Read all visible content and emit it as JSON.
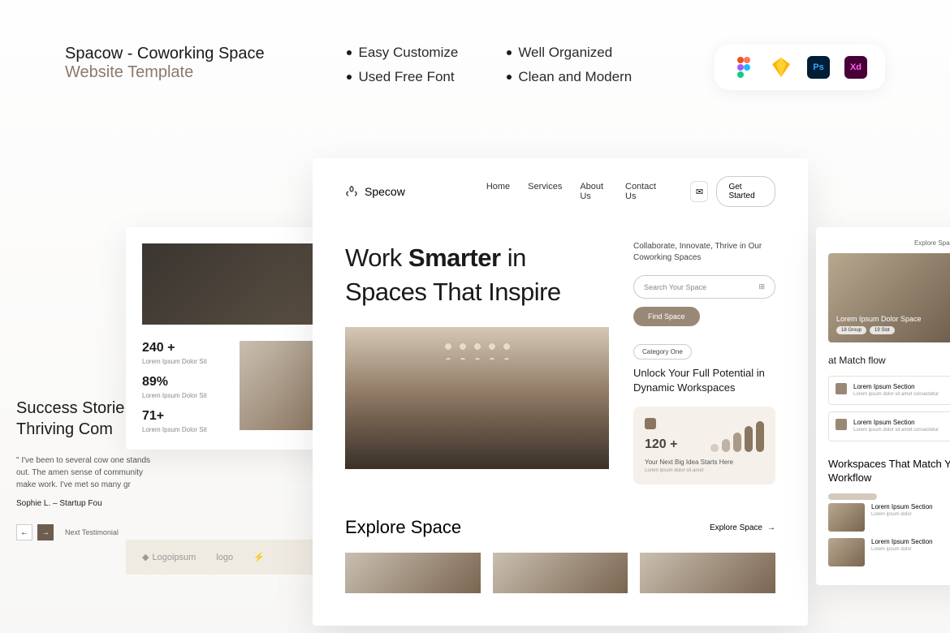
{
  "header": {
    "title_main": "Spacow - Coworking Space",
    "title_sub": "Website Template",
    "features_col1": [
      "Easy Customize",
      "Used Free Font"
    ],
    "features_col2": [
      "Well Organized",
      "Clean and Modern"
    ]
  },
  "left_card": {
    "stats": [
      {
        "num": "240 +",
        "label": "Lorem Ipsum Dolor Sit"
      },
      {
        "num": "89%",
        "label": "Lorem Ipsum Dolor Sit"
      },
      {
        "num": "71+",
        "label": "Lorem Ipsum Dolor Sit"
      }
    ]
  },
  "far_left": {
    "title": "Success Storie Thriving Com",
    "quote": "\" I've been to several cow one stands out. The amen sense of community make work. I've met so many gr",
    "author": "Sophie L. – Startup Fou",
    "next_label": "Next Testimonial"
  },
  "logos": [
    "Logoipsum",
    "logo"
  ],
  "main": {
    "brand": "Specow",
    "nav": [
      "Home",
      "Services",
      "About Us",
      "Contact Us"
    ],
    "cta": "Get Started",
    "hero_title_pre": "Work ",
    "hero_title_bold": "Smarter",
    "hero_title_post": " in Spaces That Inspire",
    "tagline": "Collaborate, Innovate, Thrive in Our Coworking Spaces",
    "search_placeholder": "Search Your Space",
    "find_btn": "Find Space",
    "category_chip": "Category One",
    "sub_headline": "Unlock Your Full Potential in Dynamic Workspaces",
    "stat_big": "120 +",
    "stat_sub": "Your Next Big Idea Starts Here",
    "stat_tiny": "Lorem ipsum dolor sit amet",
    "explore_title": "Explore Space",
    "explore_link": "Explore Space"
  },
  "right": {
    "top_link": "Explore Space",
    "img_title": "Lorem Ipsum Dolor Space",
    "chip1": "18 Group",
    "chip2": "19 Slot",
    "section1_title": "at Match flow",
    "items": [
      {
        "title": "Lorem Ipsum Section",
        "sub": "Lorem ipsum dolor sit amet consectetur"
      },
      {
        "title": "Lorem Ipsum Section",
        "sub": "Lorem ipsum dolor sit amet consectetur"
      }
    ],
    "workspace_title": "Workspaces That Match Your Workflow",
    "ws_items": [
      {
        "title": "Lorem Ipsum Section"
      },
      {
        "title": "Lorem Ipsum Section"
      }
    ]
  }
}
